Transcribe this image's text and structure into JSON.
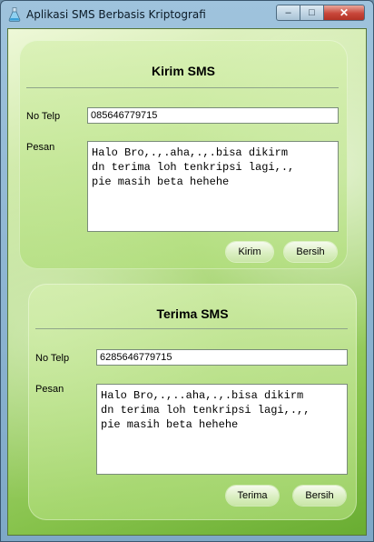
{
  "window": {
    "title": "Aplikasi SMS Berbasis Kriptografi",
    "controls": {
      "minimize": "–",
      "maximize": "□",
      "close": "✕"
    },
    "icon": "flask-icon"
  },
  "send_panel": {
    "title": "Kirim SMS",
    "phone_label": "No Telp",
    "phone_value": "085646779715",
    "message_label": "Pesan",
    "message_value": "Halo Bro,.,.aha,.,.bisa dikirm\ndn terima loh tenkripsi lagi,.,\npie masih beta hehehe",
    "send_button": "Kirim",
    "clear_button": "Bersih"
  },
  "receive_panel": {
    "title": "Terima SMS",
    "phone_label": "No Telp",
    "phone_value": "6285646779715",
    "message_label": "Pesan",
    "message_value": "Halo Bro,.,..aha,.,.bisa dikirm\ndn terima loh tenkripsi lagi,.,,\npie masih beta hehehe",
    "receive_button": "Terima",
    "clear_button": "Bersih"
  }
}
